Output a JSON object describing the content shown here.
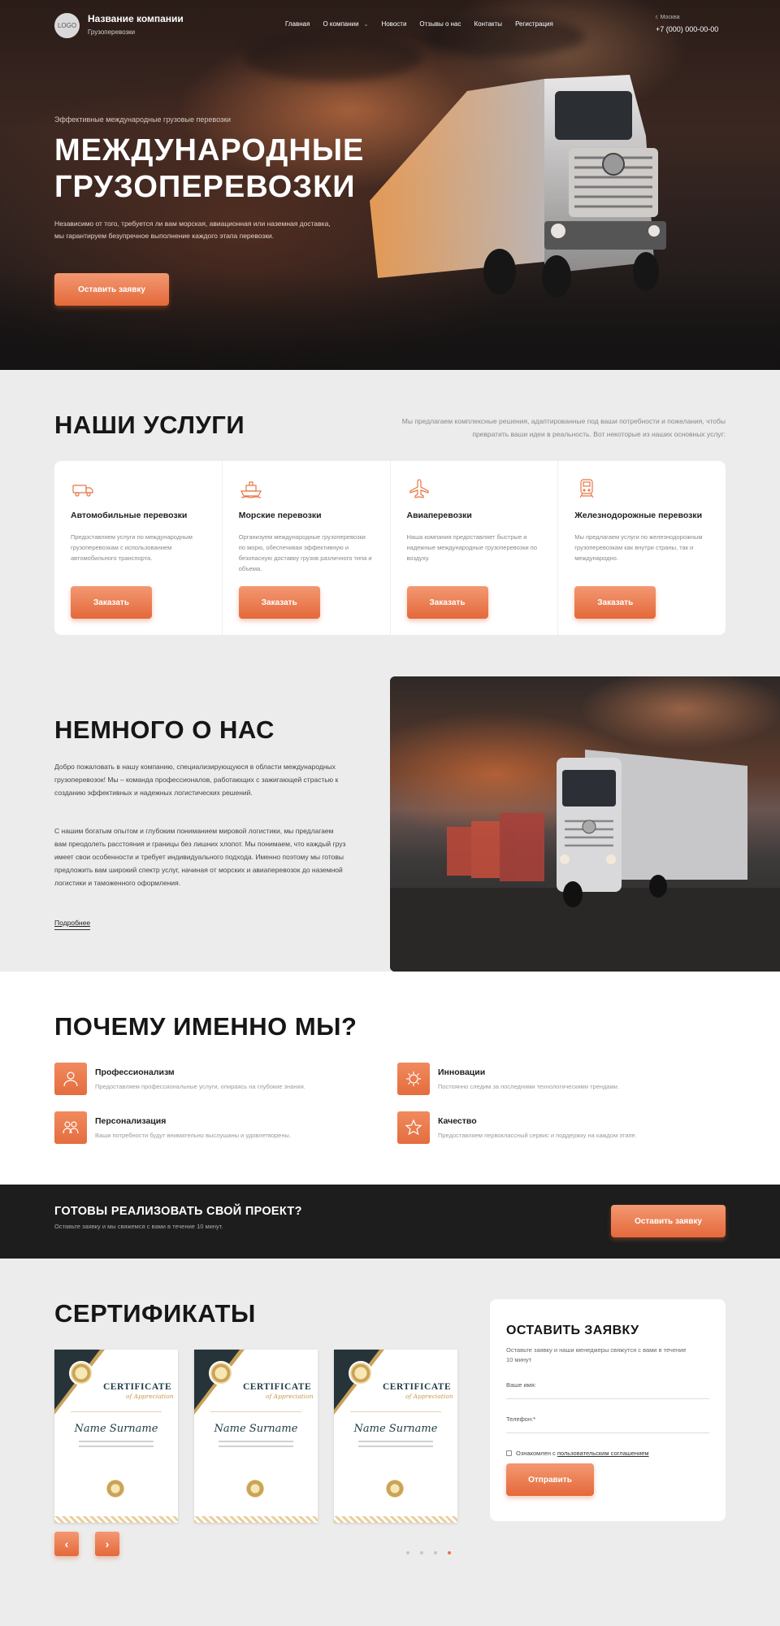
{
  "header": {
    "logo_text": "LOGO",
    "company_name": "Название компании",
    "company_sub": "Грузоперевозки",
    "nav": [
      "Главная",
      "О компании",
      "Новости",
      "Отзывы о нас",
      "Контакты",
      "Регистрация"
    ],
    "city": "г. Москва",
    "phone": "+7 (000) 000-00-00"
  },
  "hero": {
    "pretitle": "Эффективные международные грузовые перевозки",
    "title_line1": "МЕЖДУНАРОДНЫЕ",
    "title_line2": "ГРУЗОПЕРЕВОЗКИ",
    "description": "Независимо от того, требуется ли вам морская, авиационная или наземная доставка, мы гарантируем безупречное выполнение каждого этапа перевозки.",
    "button": "Оставить заявку"
  },
  "services": {
    "title": "НАШИ УСЛУГИ",
    "description": "Мы предлагаем комплексные решения, адаптированные под ваши потребности и пожелания, чтобы превратить ваши идеи в реальность. Вот некоторые из наших основных услуг:",
    "items": [
      {
        "icon": "truck-icon",
        "title": "Автомобильные перевозки",
        "text": "Предоставляем услуги по международным грузоперевозкам с использованием автомобильного транспорта.",
        "button": "Заказать"
      },
      {
        "icon": "ship-icon",
        "title": "Морские перевозки",
        "text": "Организуем международные грузоперевозки по морю, обеспечивая эффективную и безопасную доставку грузов различного типа и объема.",
        "button": "Заказать"
      },
      {
        "icon": "plane-icon",
        "title": "Авиаперевозки",
        "text": "Наша компания предоставляет быстрые и надежные международные грузоперевозки по воздуху.",
        "button": "Заказать"
      },
      {
        "icon": "train-icon",
        "title": "Железнодорожные перевозки",
        "text": "Мы предлагаем услуги по железнодорожным грузоперевозкам как внутри страны, так и международно.",
        "button": "Заказать"
      }
    ]
  },
  "about": {
    "title": "НЕМНОГО О НАС",
    "paragraph1": "Добро пожаловать в нашу компанию, специализирующуюся в области международных грузоперевозок! Мы – команда профессионалов, работающих с зажигающей страстью к созданию эффективных и надежных логистических решений.",
    "paragraph2": "С нашим богатым опытом и глубоким пониманием мировой логистики, мы предлагаем вам преодолеть расстояния и границы без лишних хлопот. Мы понимаем, что каждый груз имеет свои особенности и требует индивидуального подхода. Именно поэтому мы готовы предложить вам широкий спектр услуг, начиная от морских и авиаперевозок до наземной логистики и таможенного оформления.",
    "more": "Подробнее"
  },
  "why": {
    "title": "ПОЧЕМУ ИМЕННО МЫ?",
    "features": [
      {
        "icon": "professional-icon",
        "title": "Профессионализм",
        "text": "Предоставляем профессиональные услуги, опираясь на глубокие знания."
      },
      {
        "icon": "innovation-icon",
        "title": "Инновации",
        "text": "Постоянно следим за последними технологическими трендами."
      },
      {
        "icon": "personalization-icon",
        "title": "Персонализация",
        "text": "Ваши потребности будут внимательно выслушаны и удовлетворены."
      },
      {
        "icon": "quality-star-icon",
        "title": "Качество",
        "text": "Предоставляем первоклассный сервис и поддержку на каждом этапе."
      }
    ]
  },
  "cta": {
    "title": "ГОТОВЫ РЕАЛИЗОВАТЬ СВОЙ ПРОЕКТ?",
    "subtitle": "Оставьте заявку и мы свяжемся с вами в течение 10 минут.",
    "button": "Оставить заявку"
  },
  "certificates": {
    "title": "СЕРТИФИКАТЫ",
    "cert_heading": "CERTIFICATE",
    "cert_sub": "of Appreciation",
    "cert_name": "Name Surname",
    "count": 3,
    "prev_icon": "arrow-left-icon",
    "next_icon": "arrow-right-icon",
    "dots_total": 4,
    "dots_active": 4
  },
  "form": {
    "title": "ОСТАВИТЬ ЗАЯВКУ",
    "subtitle": "Оставьте заявку и наши менеджеры свяжутся с вами в течение 10 минут",
    "name_label": "Ваше имя:",
    "phone_label": "Телефон:*",
    "agree_text": "Ознакомлен с ",
    "agree_link": "пользовательским соглашением",
    "button": "Отправить"
  },
  "colors": {
    "accent": "#e87444",
    "dark": "#1d1d1d",
    "background": "#ececec"
  }
}
